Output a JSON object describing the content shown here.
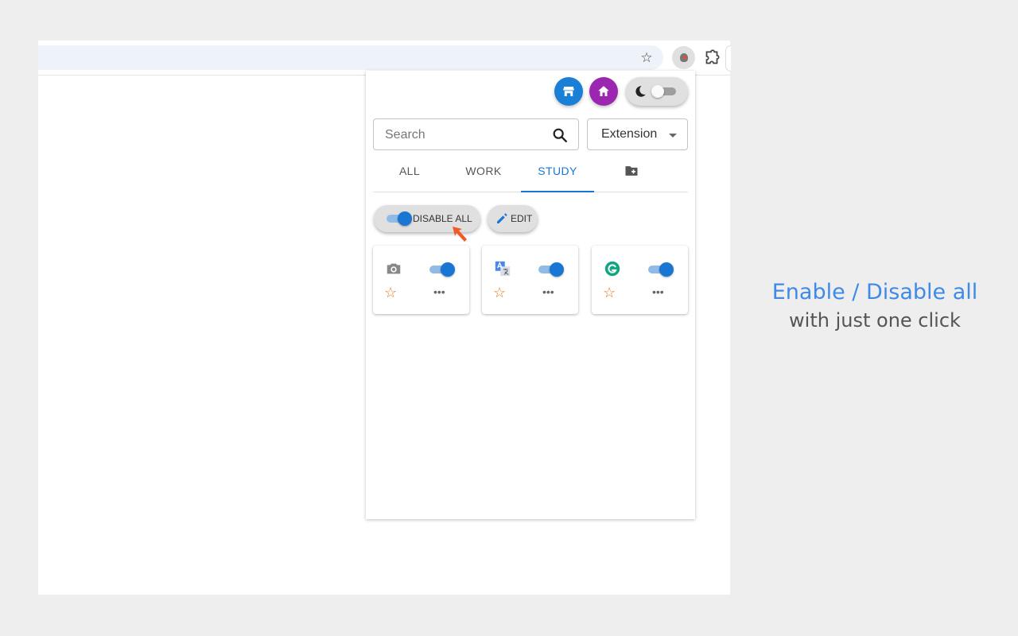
{
  "browser": {
    "bookmark_star_glyph": "☆",
    "active_extension_icon": "extension-logo-icon",
    "extensions_menu_icon": "puzzle-icon"
  },
  "popup": {
    "header_buttons": {
      "store_icon": "store-icon",
      "home_icon": "home-icon",
      "theme_icon": "moon-icon",
      "dark_mode_on": false
    },
    "search": {
      "placeholder": "Search",
      "value": ""
    },
    "filter_select": {
      "value": "Extension"
    },
    "tabs": [
      {
        "label": "ALL",
        "active": false
      },
      {
        "label": "WORK",
        "active": false
      },
      {
        "label": "STUDY",
        "active": true
      },
      {
        "label": "",
        "icon": "folder-add-icon",
        "active": false
      }
    ],
    "actions": {
      "disable_all_label": "DISABLE ALL",
      "disable_all_on": true,
      "edit_label": "EDIT"
    },
    "extensions": [
      {
        "icon": "camera-icon",
        "enabled": true,
        "favorite_glyph": "☆",
        "more_glyph": "•••"
      },
      {
        "icon": "translate-icon",
        "enabled": true,
        "favorite_glyph": "☆",
        "more_glyph": "•••"
      },
      {
        "icon": "grammarly-icon",
        "enabled": true,
        "favorite_glyph": "☆",
        "more_glyph": "•••"
      }
    ]
  },
  "caption": {
    "title": "Enable / Disable all",
    "subtitle": "with just one click"
  },
  "colors": {
    "accent_blue": "#1976d2",
    "store_button": "#1a7fd6",
    "home_button": "#9b27b0",
    "favorite_star": "#e87722",
    "pointer_arrow": "#f05a28",
    "caption_title": "#3f8ae8"
  }
}
